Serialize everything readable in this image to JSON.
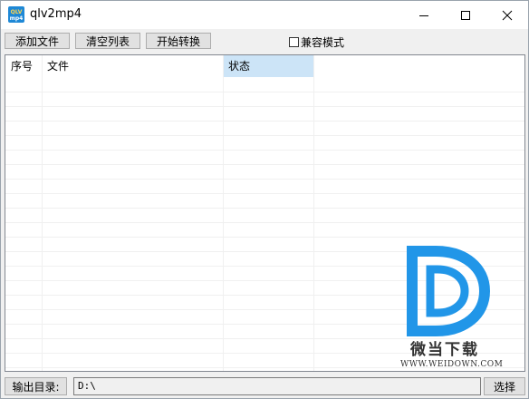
{
  "window": {
    "title": "qlv2mp4",
    "icon_text": "QLV mp4"
  },
  "window_controls": {
    "minimize": "minimize-icon",
    "maximize": "maximize-icon",
    "close": "close-icon"
  },
  "toolbar": {
    "add_files": "添加文件",
    "clear_list": "清空列表",
    "start_convert": "开始转换",
    "compat_mode": "兼容模式",
    "compat_checked": false
  },
  "table": {
    "columns": [
      "序号",
      "文件",
      "状态"
    ],
    "rows": []
  },
  "output": {
    "label": "输出目录:",
    "value": "D:\\",
    "select_label": "选择"
  },
  "watermark": {
    "brand": "微当下载",
    "url": "WWW.WEIDOWN.COM"
  },
  "colors": {
    "header_highlight": "#cce4f7",
    "watermark_blue": "#2196e8",
    "titlebar": "#ffffff"
  }
}
